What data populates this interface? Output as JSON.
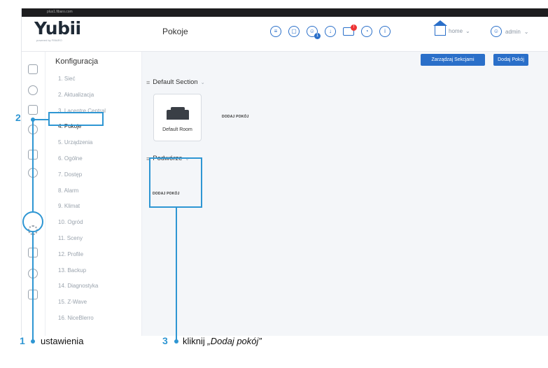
{
  "browser": {
    "url": "plus1.fibaro.com"
  },
  "app": {
    "logo": "Yubii",
    "logo_sub": "powered by FIBARO",
    "page_title": "Pokoje"
  },
  "header": {
    "icons": [
      "scenes-icon",
      "lock-icon",
      "users-icon",
      "download-icon",
      "mail-icon",
      "dashboard-icon",
      "info-icon"
    ],
    "home_label": "home",
    "user_label": "admin"
  },
  "sidebar": {
    "title": "Konfiguracja",
    "items": [
      {
        "label": "1. Sieć"
      },
      {
        "label": "2. Aktualizacja"
      },
      {
        "label": "3. Lacentre Central"
      },
      {
        "label": "4. Pokoje",
        "active": true
      },
      {
        "label": "5. Urządzenia"
      },
      {
        "label": "6. Ogólne"
      },
      {
        "label": "7. Dostęp"
      },
      {
        "label": "8. Alarm"
      },
      {
        "label": "9. Klimat"
      },
      {
        "label": "10. Ogród"
      },
      {
        "label": "11. Sceny"
      },
      {
        "label": "12. Profile"
      },
      {
        "label": "13. Backup"
      },
      {
        "label": "14. Diagnostyka"
      },
      {
        "label": "15. Z-Wave"
      },
      {
        "label": "16. NiceBlerro"
      }
    ]
  },
  "toolbar": {
    "manage_sections": "Zarządzaj Sekcjami",
    "add_room": "Dodaj Pokój"
  },
  "sections": [
    {
      "name": "Default Section",
      "rooms": [
        {
          "name": "Default Room"
        }
      ],
      "add_room_label": "DODAJ POKÓJ"
    },
    {
      "name": "Podwórze",
      "rooms": [],
      "add_room_label": "DODAJ POKÓJ"
    }
  ],
  "annotations": [
    {
      "number": "1",
      "text": "ustawienia"
    },
    {
      "number": "2",
      "text": ""
    },
    {
      "number": "3",
      "text_prefix": "kliknij ",
      "text_italic": "„Dodaj pokój”"
    }
  ],
  "colors": {
    "accent": "#2a6fc9",
    "annotation": "#2e96d3",
    "background": "#f4f6f9"
  }
}
